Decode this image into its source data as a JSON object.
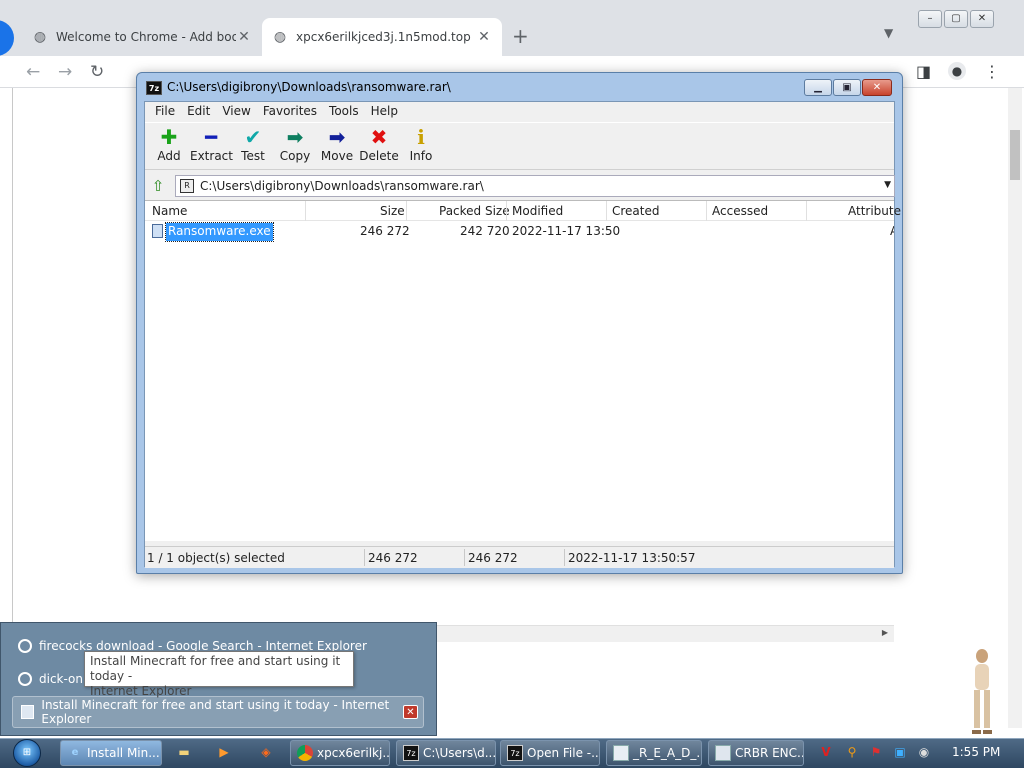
{
  "chrome": {
    "tabs": [
      {
        "title": "Welcome to Chrome - Add book"
      },
      {
        "title": "xpcx6erilkjced3j.1n5mod.top"
      }
    ],
    "new_tab": "+",
    "tab_close": "✕",
    "window_buttons": [
      "–",
      "▢",
      "✕"
    ]
  },
  "sevenzip": {
    "title": "C:\\Users\\digibrony\\Downloads\\ransomware.rar\\",
    "menu": [
      "File",
      "Edit",
      "View",
      "Favorites",
      "Tools",
      "Help"
    ],
    "toolbar": [
      {
        "label": "Add",
        "icon": "add-icon",
        "glyph": "✚"
      },
      {
        "label": "Extract",
        "icon": "extract-icon",
        "glyph": "━"
      },
      {
        "label": "Test",
        "icon": "test-icon",
        "glyph": "✔"
      },
      {
        "label": "Copy",
        "icon": "copy-icon",
        "glyph": "➡"
      },
      {
        "label": "Move",
        "icon": "move-icon",
        "glyph": "➡"
      },
      {
        "label": "Delete",
        "icon": "delete-icon",
        "glyph": "✖"
      },
      {
        "label": "Info",
        "icon": "info-icon",
        "glyph": "i"
      }
    ],
    "address": "C:\\Users\\digibrony\\Downloads\\ransomware.rar\\",
    "columns": [
      "Name",
      "Size",
      "Packed Size",
      "Modified",
      "Created",
      "Accessed",
      "Attribute"
    ],
    "rows": [
      {
        "name": "Ransomware.exe",
        "size": "246 272",
        "packed": "242 720",
        "modified": "2022-11-17 13:50",
        "created": "",
        "accessed": "",
        "attr": "A"
      }
    ],
    "status": {
      "selected": "1 / 1 object(s) selected",
      "size": "246 272",
      "packed": "246 272",
      "modified": "2022-11-17 13:50:57"
    }
  },
  "popup": {
    "items": [
      {
        "title": "firecocks download - Google Search - Internet Explorer"
      },
      {
        "title": "dick-on"
      },
      {
        "title": "Install Minecraft for free and start using it today - Internet Explorer"
      }
    ],
    "tooltip_line1": "Install Minecraft for free and start using it today -",
    "tooltip_line2": "Internet Explorer"
  },
  "taskbar": {
    "buttons": [
      {
        "label": "Install Min..."
      },
      {
        "label": "xpcx6erilkj..."
      },
      {
        "label": "C:\\Users\\d..."
      },
      {
        "label": "Open File -..."
      },
      {
        "label": "_R_E_A_D_..."
      },
      {
        "label": "CRBR ENC..."
      }
    ],
    "clock": "1:55 PM"
  }
}
